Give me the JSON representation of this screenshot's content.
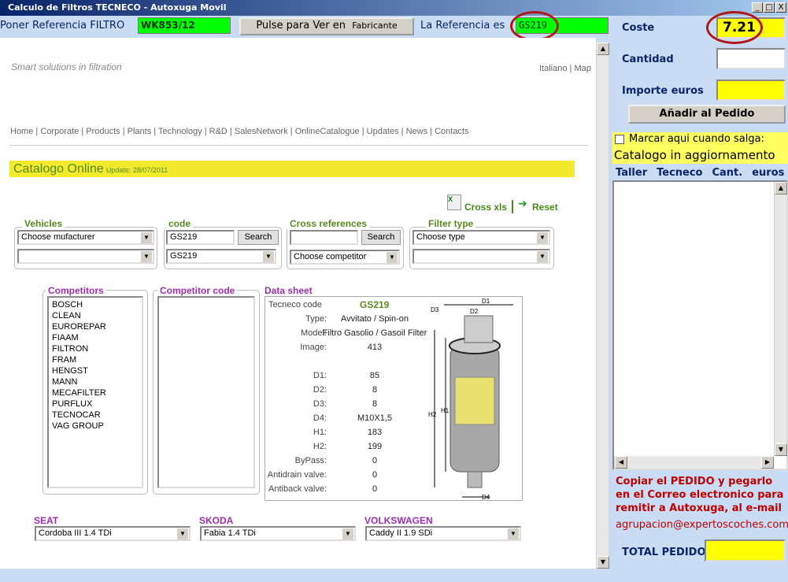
{
  "window": {
    "title": "Calculo de Filtros TECNECO - Autoxuga Movil",
    "controls": [
      "_",
      "□",
      "X"
    ]
  },
  "toolbar": {
    "ref_label": "Poner Referencia FILTRO",
    "ref_value": "WK853/12",
    "button_main": "Pulse para Ver en",
    "button_sub": "Fabricante",
    "result_label": "La Referencia es",
    "result_value": "GS219"
  },
  "site": {
    "tagline": "Smart solutions in filtration",
    "lang_links": [
      "Italiano",
      "Map"
    ],
    "nav": [
      "Home",
      "Corporate",
      "Products",
      "Plants",
      "Technology",
      "R&D",
      "SalesNetwork",
      "OnlineCatalogue",
      "Updates",
      "News",
      "Contacts"
    ],
    "banner_title": "Catalogo Online",
    "banner_update": "Update: 28/07/2011",
    "cross_xls": "Cross xls",
    "reset": "Reset",
    "vehicles": {
      "label": "Vehicles",
      "select1": "Choose mufacturer",
      "select2": ""
    },
    "code": {
      "label": "code",
      "input": "GS219",
      "search": "Search",
      "select": "GS219"
    },
    "cross": {
      "label": "Cross references",
      "input": "",
      "search": "Search",
      "select": "Choose competitor"
    },
    "filter_type": {
      "label": "Filter type",
      "select1": "Choose type",
      "select2": ""
    },
    "competitors": {
      "label": "Competitors",
      "items": [
        "BOSCH",
        "CLEAN",
        "EUROREPAR",
        "FIAAM",
        "FILTRON",
        "FRAM",
        "HENGST",
        "MANN",
        "MECAFILTER",
        "PURFLUX",
        "TECNOCAR",
        "VAG GROUP"
      ]
    },
    "competitor_code": {
      "label": "Competitor code"
    },
    "datasheet": {
      "label": "Data sheet",
      "code_label": "Tecneco code",
      "code": "GS219",
      "rows": [
        [
          "Type:",
          "Avvitato / Spin-on"
        ],
        [
          "Model:",
          "Filtro Gasolio / Gasoil Filter"
        ],
        [
          "Image:",
          "413"
        ],
        [
          "",
          ""
        ],
        [
          "D1:",
          "85"
        ],
        [
          "D2:",
          "8"
        ],
        [
          "D3:",
          "8"
        ],
        [
          "D4:",
          "M10X1,5"
        ],
        [
          "H1:",
          "183"
        ],
        [
          "H2:",
          "199"
        ],
        [
          "ByPass:",
          "0"
        ],
        [
          "Antidrain valve:",
          "0"
        ],
        [
          "Antiback valve:",
          "0"
        ]
      ],
      "dims": [
        "D1",
        "D2",
        "D3",
        "D4",
        "H1",
        "H2"
      ]
    },
    "makes": [
      {
        "name": "SEAT",
        "model": "Cordoba III 1.4 TDi"
      },
      {
        "name": "SKODA",
        "model": "Fabia 1.4 TDi"
      },
      {
        "name": "VOLKSWAGEN",
        "model": "Caddy II 1.9 SDi"
      }
    ]
  },
  "panel": {
    "coste_label": "Coste",
    "coste": "7.21",
    "cantidad_label": "Cantidad",
    "cantidad": "",
    "importe_label": "Importe euros",
    "importe": "",
    "add_button": "Añadir al Pedido",
    "checkbox_label": "Marcar aqui cuando salga:",
    "status": "Catalogo in aggiornamento",
    "columns": [
      "Taller",
      "Tecneco",
      "Cant.",
      "euros"
    ],
    "instructions": "Copiar el PEDIDO y pegarlo en el Correo electronico para remitir a Autoxuga, al e-mail",
    "email": "agrupacion@expertoscoches.com",
    "total_label": "TOTAL PEDIDO",
    "total": ""
  },
  "colors": {
    "highlight_green": "#00ff00",
    "highlight_yellow": "#ffff00",
    "banner_yellow": "#f2ea2c",
    "circle_red": "#b01818"
  }
}
